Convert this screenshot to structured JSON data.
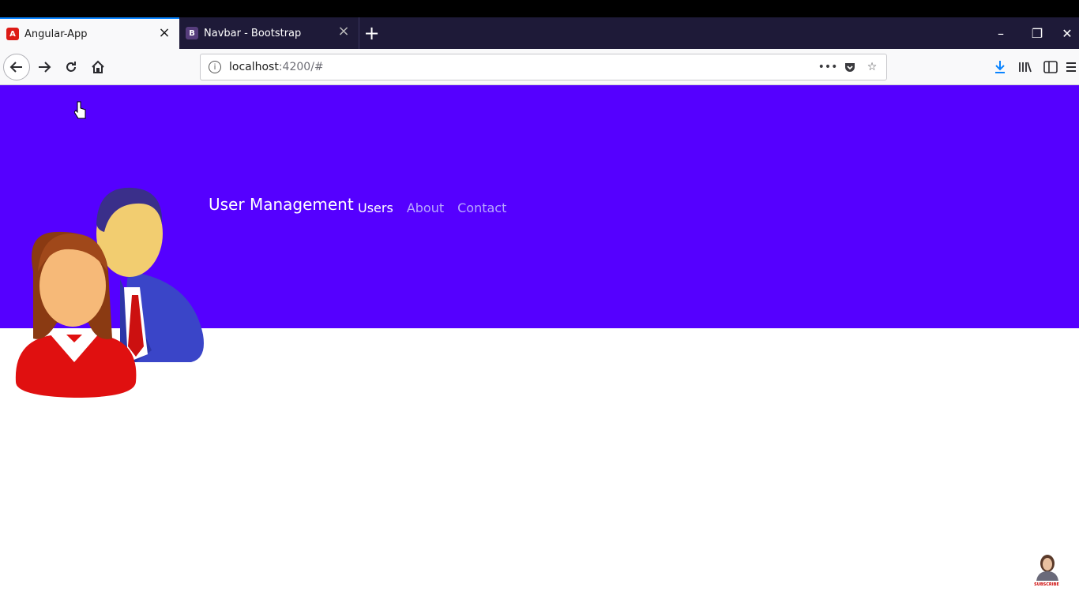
{
  "browser": {
    "tabs": [
      {
        "title": "Angular-App",
        "favicon": "angular-icon",
        "favicon_letter": "A",
        "favicon_color": "#dd1b16",
        "active": true
      },
      {
        "title": "Navbar - Bootstrap",
        "favicon": "bootstrap-icon",
        "favicon_letter": "B",
        "favicon_color": "#563d7c",
        "active": false
      }
    ],
    "url_host": "localhost",
    "url_path": ":4200/#"
  },
  "app": {
    "brand": "User Management",
    "nav": [
      {
        "label": "Users",
        "active": true
      },
      {
        "label": "About",
        "active": false
      },
      {
        "label": "Contact",
        "active": false
      }
    ],
    "header_color": "#5500ff"
  },
  "overlay": {
    "subscribe_label": "SUBSCRIBE"
  }
}
